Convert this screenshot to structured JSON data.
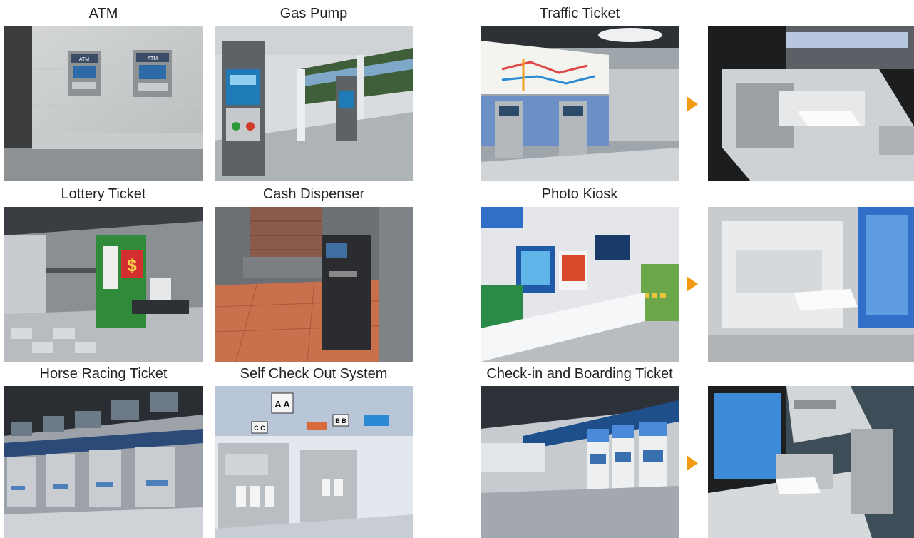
{
  "captions": {
    "atm": "ATM",
    "gas_pump": "Gas Pump",
    "traffic_ticket": "Traffic Ticket",
    "lottery_ticket": "Lottery Ticket",
    "cash_dispenser": "Cash Dispenser",
    "photo_kiosk": "Photo Kiosk",
    "horse_racing_ticket": "Horse Racing Ticket",
    "self_check_out": "Self Check Out System",
    "check_in_boarding": "Check-in and Boarding Ticket"
  },
  "in_image_text": {
    "atm_sign": "ATM",
    "lottery_sign": "$",
    "checkout_sign_main": "A A",
    "checkout_sign_left": "C C",
    "checkout_sign_right": "B B"
  },
  "colors": {
    "arrow": "#f29a12",
    "kiosk_blue": "#2f6fc8",
    "lottery_green": "#2f8a3a"
  },
  "icons": {
    "arrow": "triangle-right-icon"
  }
}
